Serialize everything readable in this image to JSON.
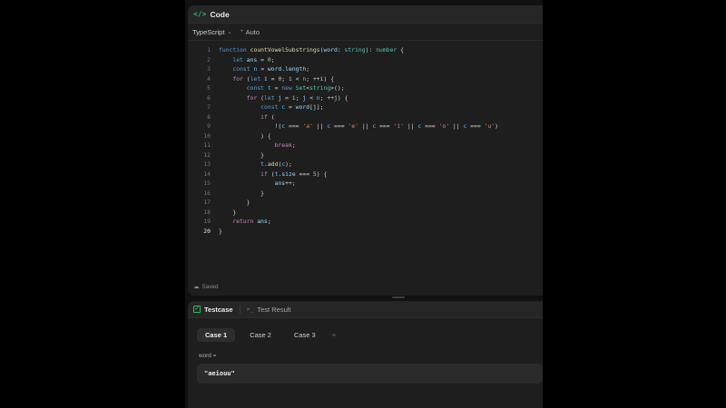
{
  "code_panel": {
    "title": "Code",
    "icon": "code-icon",
    "language": "TypeScript",
    "mode": "Auto",
    "status": "Saved"
  },
  "editor": {
    "active_line": 20,
    "lines": [
      [
        {
          "t": "function ",
          "c": "#569cd6"
        },
        {
          "t": "countVowelSubstrings",
          "c": "#dcdcaa"
        },
        {
          "t": "(",
          "c": "#d4d4d4"
        },
        {
          "t": "word",
          "c": "#9cdcfe"
        },
        {
          "t": ": ",
          "c": "#d4d4d4"
        },
        {
          "t": "string",
          "c": "#4ec9b0"
        },
        {
          "t": "): ",
          "c": "#d4d4d4"
        },
        {
          "t": "number",
          "c": "#4ec9b0"
        },
        {
          "t": " {",
          "c": "#d4d4d4"
        }
      ],
      [
        {
          "t": "    let ",
          "c": "#569cd6"
        },
        {
          "t": "ans",
          "c": "#9cdcfe"
        },
        {
          "t": " = ",
          "c": "#d4d4d4"
        },
        {
          "t": "0",
          "c": "#b5cea8"
        },
        {
          "t": ";",
          "c": "#d4d4d4"
        }
      ],
      [
        {
          "t": "    const ",
          "c": "#569cd6"
        },
        {
          "t": "n",
          "c": "#4fc1ff"
        },
        {
          "t": " = ",
          "c": "#d4d4d4"
        },
        {
          "t": "word",
          "c": "#9cdcfe"
        },
        {
          "t": ".",
          "c": "#d4d4d4"
        },
        {
          "t": "length",
          "c": "#9cdcfe"
        },
        {
          "t": ";",
          "c": "#d4d4d4"
        }
      ],
      [
        {
          "t": "    for ",
          "c": "#c586c0"
        },
        {
          "t": "(",
          "c": "#d4d4d4"
        },
        {
          "t": "let ",
          "c": "#569cd6"
        },
        {
          "t": "i",
          "c": "#9cdcfe"
        },
        {
          "t": " = ",
          "c": "#d4d4d4"
        },
        {
          "t": "0",
          "c": "#b5cea8"
        },
        {
          "t": "; ",
          "c": "#d4d4d4"
        },
        {
          "t": "i",
          "c": "#9cdcfe"
        },
        {
          "t": " < ",
          "c": "#d4d4d4"
        },
        {
          "t": "n",
          "c": "#4fc1ff"
        },
        {
          "t": "; ++",
          "c": "#d4d4d4"
        },
        {
          "t": "i",
          "c": "#9cdcfe"
        },
        {
          "t": ") {",
          "c": "#d4d4d4"
        }
      ],
      [
        {
          "t": "        const ",
          "c": "#569cd6"
        },
        {
          "t": "t",
          "c": "#4fc1ff"
        },
        {
          "t": " = ",
          "c": "#d4d4d4"
        },
        {
          "t": "new ",
          "c": "#569cd6"
        },
        {
          "t": "Set",
          "c": "#4ec9b0"
        },
        {
          "t": "<",
          "c": "#d4d4d4"
        },
        {
          "t": "string",
          "c": "#4ec9b0"
        },
        {
          "t": ">();",
          "c": "#d4d4d4"
        }
      ],
      [
        {
          "t": "        for ",
          "c": "#c586c0"
        },
        {
          "t": "(",
          "c": "#d4d4d4"
        },
        {
          "t": "let ",
          "c": "#569cd6"
        },
        {
          "t": "j",
          "c": "#9cdcfe"
        },
        {
          "t": " = ",
          "c": "#d4d4d4"
        },
        {
          "t": "i",
          "c": "#9cdcfe"
        },
        {
          "t": "; ",
          "c": "#d4d4d4"
        },
        {
          "t": "j",
          "c": "#9cdcfe"
        },
        {
          "t": " < ",
          "c": "#d4d4d4"
        },
        {
          "t": "n",
          "c": "#4fc1ff"
        },
        {
          "t": "; ++",
          "c": "#d4d4d4"
        },
        {
          "t": "j",
          "c": "#9cdcfe"
        },
        {
          "t": ") {",
          "c": "#d4d4d4"
        }
      ],
      [
        {
          "t": "            const ",
          "c": "#569cd6"
        },
        {
          "t": "c",
          "c": "#4fc1ff"
        },
        {
          "t": " = ",
          "c": "#d4d4d4"
        },
        {
          "t": "word",
          "c": "#9cdcfe"
        },
        {
          "t": "[",
          "c": "#d4d4d4"
        },
        {
          "t": "j",
          "c": "#9cdcfe"
        },
        {
          "t": "];",
          "c": "#d4d4d4"
        }
      ],
      [
        {
          "t": "            if ",
          "c": "#c586c0"
        },
        {
          "t": "(",
          "c": "#d4d4d4"
        }
      ],
      [
        {
          "t": "                !(",
          "c": "#d4d4d4"
        },
        {
          "t": "c",
          "c": "#4fc1ff"
        },
        {
          "t": " === ",
          "c": "#d4d4d4"
        },
        {
          "t": "'a'",
          "c": "#ce9178"
        },
        {
          "t": " || ",
          "c": "#d4d4d4"
        },
        {
          "t": "c",
          "c": "#4fc1ff"
        },
        {
          "t": " === ",
          "c": "#d4d4d4"
        },
        {
          "t": "'e'",
          "c": "#ce9178"
        },
        {
          "t": " || ",
          "c": "#d4d4d4"
        },
        {
          "t": "c",
          "c": "#4fc1ff"
        },
        {
          "t": " === ",
          "c": "#d4d4d4"
        },
        {
          "t": "'i'",
          "c": "#ce9178"
        },
        {
          "t": " || ",
          "c": "#d4d4d4"
        },
        {
          "t": "c",
          "c": "#4fc1ff"
        },
        {
          "t": " === ",
          "c": "#d4d4d4"
        },
        {
          "t": "'o'",
          "c": "#ce9178"
        },
        {
          "t": " || ",
          "c": "#d4d4d4"
        },
        {
          "t": "c",
          "c": "#4fc1ff"
        },
        {
          "t": " === ",
          "c": "#d4d4d4"
        },
        {
          "t": "'u'",
          "c": "#ce9178"
        },
        {
          "t": ")",
          "c": "#d4d4d4"
        }
      ],
      [
        {
          "t": "            ) {",
          "c": "#d4d4d4"
        }
      ],
      [
        {
          "t": "                break",
          "c": "#c586c0"
        },
        {
          "t": ";",
          "c": "#d4d4d4"
        }
      ],
      [
        {
          "t": "            }",
          "c": "#d4d4d4"
        }
      ],
      [
        {
          "t": "            t",
          "c": "#4fc1ff"
        },
        {
          "t": ".",
          "c": "#d4d4d4"
        },
        {
          "t": "add",
          "c": "#dcdcaa"
        },
        {
          "t": "(",
          "c": "#d4d4d4"
        },
        {
          "t": "c",
          "c": "#4fc1ff"
        },
        {
          "t": ");",
          "c": "#d4d4d4"
        }
      ],
      [
        {
          "t": "            if ",
          "c": "#c586c0"
        },
        {
          "t": "(",
          "c": "#d4d4d4"
        },
        {
          "t": "t",
          "c": "#4fc1ff"
        },
        {
          "t": ".",
          "c": "#d4d4d4"
        },
        {
          "t": "size",
          "c": "#9cdcfe"
        },
        {
          "t": " === ",
          "c": "#d4d4d4"
        },
        {
          "t": "5",
          "c": "#b5cea8"
        },
        {
          "t": ") {",
          "c": "#d4d4d4"
        }
      ],
      [
        {
          "t": "                ans",
          "c": "#9cdcfe"
        },
        {
          "t": "++;",
          "c": "#d4d4d4"
        }
      ],
      [
        {
          "t": "            }",
          "c": "#d4d4d4"
        }
      ],
      [
        {
          "t": "        }",
          "c": "#d4d4d4"
        }
      ],
      [
        {
          "t": "    }",
          "c": "#d4d4d4"
        }
      ],
      [
        {
          "t": "    return ",
          "c": "#c586c0"
        },
        {
          "t": "ans",
          "c": "#9cdcfe"
        },
        {
          "t": ";",
          "c": "#d4d4d4"
        }
      ],
      [
        {
          "t": "}",
          "c": "#d4d4d4"
        }
      ]
    ]
  },
  "test_panel": {
    "tabs": [
      {
        "label": "Testcase",
        "icon": "check-square-icon"
      },
      {
        "label": "Test Result",
        "icon": "terminal-icon"
      }
    ],
    "cases": [
      "Case 1",
      "Case 2",
      "Case 3"
    ],
    "add_symbol": "+",
    "input_label": "word =",
    "input_value": "\"aeiouu\""
  },
  "colors": {
    "accent": "#2cbb5d",
    "editor_bg": "#1e1e1e",
    "header_bg": "#262626",
    "page_bg": "#000000"
  }
}
